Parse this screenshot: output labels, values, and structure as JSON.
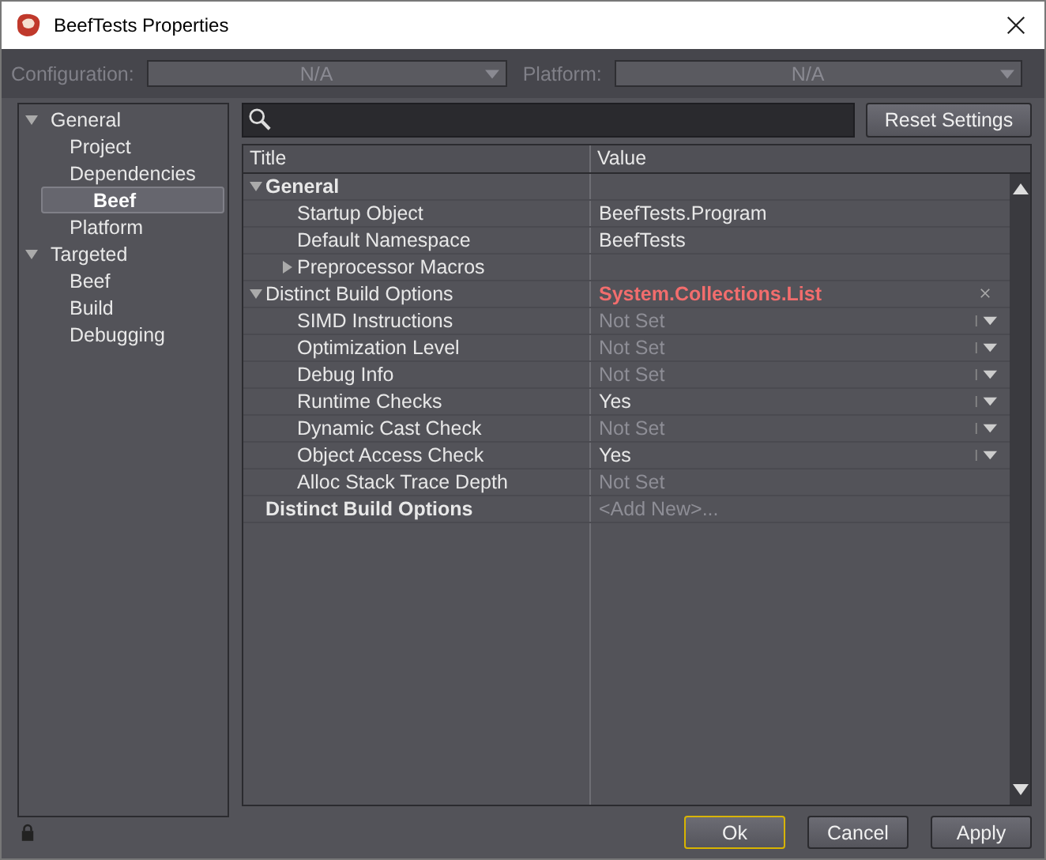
{
  "window": {
    "title": "BeefTests Properties"
  },
  "config_bar": {
    "configuration_label": "Configuration:",
    "configuration_value": "N/A",
    "platform_label": "Platform:",
    "platform_value": "N/A",
    "disabled": true
  },
  "sidebar": {
    "items": [
      {
        "label": "General",
        "selected": false,
        "expanded": true,
        "children": [
          {
            "label": "Project",
            "selected": false
          },
          {
            "label": "Dependencies",
            "selected": false
          },
          {
            "label": "Beef",
            "selected": true
          },
          {
            "label": "Platform",
            "selected": false
          }
        ]
      },
      {
        "label": "Targeted",
        "selected": false,
        "expanded": true,
        "children": [
          {
            "label": "Beef",
            "selected": false
          },
          {
            "label": "Build",
            "selected": false
          },
          {
            "label": "Debugging",
            "selected": false
          }
        ]
      }
    ]
  },
  "reset_button": "Reset Settings",
  "grid": {
    "columns": [
      "Title",
      "Value"
    ],
    "rows": [
      {
        "kind": "group",
        "title": "General",
        "expanded": true,
        "bold": true,
        "children": [
          {
            "kind": "property",
            "title": "Startup Object",
            "value": "BeefTests.Program",
            "dimmed": false,
            "dropdown": false
          },
          {
            "kind": "property",
            "title": "Default Namespace",
            "value": "BeefTests",
            "dimmed": false,
            "dropdown": false
          },
          {
            "kind": "group",
            "title": "Preprocessor Macros",
            "expanded": false,
            "bold": false
          }
        ]
      },
      {
        "kind": "filter",
        "title": "Distinct Build Options",
        "value": "System.Collections.List",
        "expanded": true,
        "children": [
          {
            "kind": "property",
            "title": "SIMD Instructions",
            "value": "Not Set",
            "dimmed": true,
            "dropdown": true
          },
          {
            "kind": "property",
            "title": "Optimization Level",
            "value": "Not Set",
            "dimmed": true,
            "dropdown": true
          },
          {
            "kind": "property",
            "title": "Debug Info",
            "value": "Not Set",
            "dimmed": true,
            "dropdown": true
          },
          {
            "kind": "property",
            "title": "Runtime Checks",
            "value": "Yes",
            "dimmed": false,
            "dropdown": true
          },
          {
            "kind": "property",
            "title": "Dynamic Cast Check",
            "value": "Not Set",
            "dimmed": true,
            "dropdown": true
          },
          {
            "kind": "property",
            "title": "Object Access Check",
            "value": "Yes",
            "dimmed": false,
            "dropdown": true
          },
          {
            "kind": "property",
            "title": "Alloc Stack Trace Depth",
            "value": "Not Set",
            "dimmed": true,
            "dropdown": false
          }
        ]
      },
      {
        "kind": "add",
        "title": "Distinct Build Options",
        "value": "<Add New>..."
      }
    ]
  },
  "buttons": [
    {
      "label": "Ok",
      "selected": true
    },
    {
      "label": "Cancel",
      "selected": false
    },
    {
      "label": "Apply",
      "selected": false
    }
  ]
}
